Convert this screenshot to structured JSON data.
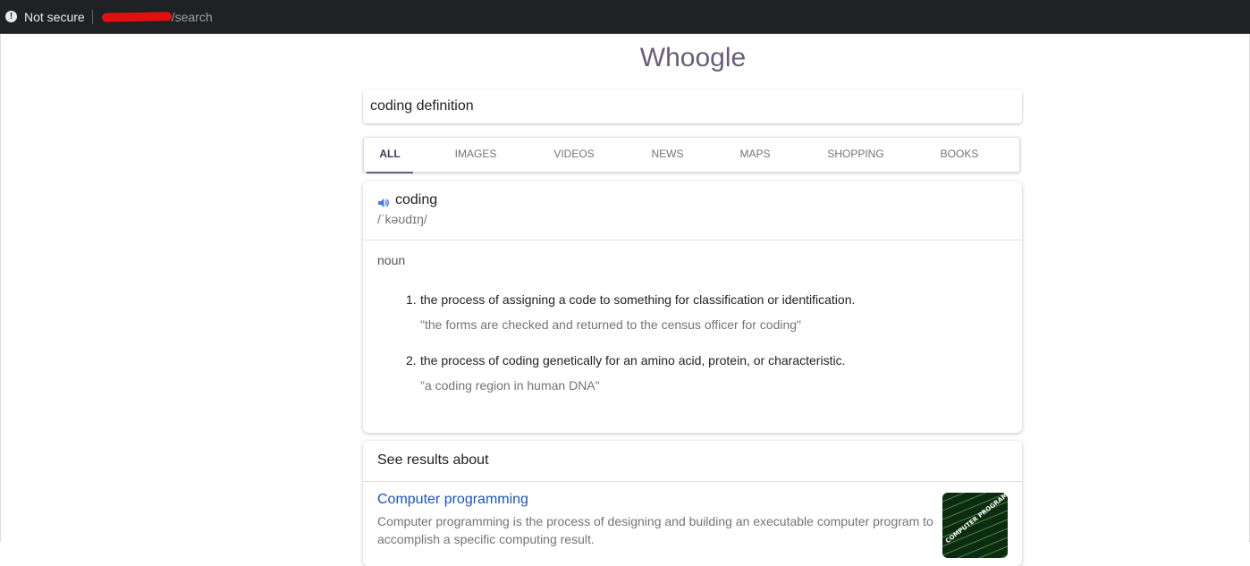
{
  "browser": {
    "security_label": "Not secure",
    "url_path": "/search"
  },
  "logo": "Whoogle",
  "search": {
    "value": "coding definition"
  },
  "tabs": [
    {
      "label": "ALL",
      "active": true
    },
    {
      "label": "IMAGES",
      "active": false
    },
    {
      "label": "VIDEOS",
      "active": false
    },
    {
      "label": "NEWS",
      "active": false
    },
    {
      "label": "MAPS",
      "active": false
    },
    {
      "label": "SHOPPING",
      "active": false
    },
    {
      "label": "BOOKS",
      "active": false
    }
  ],
  "definition": {
    "word": "coding",
    "phonetic": "/ˈkəʊdɪŋ/",
    "part_of_speech": "noun",
    "senses": [
      {
        "number": "1.",
        "text": "the process of assigning a code to something for classification or identification.",
        "example": "\"the forms are checked and returned to the census officer for coding\""
      },
      {
        "number": "2.",
        "text": "the process of coding genetically for an amino acid, protein, or characteristic.",
        "example": "\"a coding region in human DNA\""
      }
    ]
  },
  "about": {
    "title": "See results about",
    "result_title": "Computer programming",
    "result_snippet": "Computer programming is the process of designing and building an executable computer program to accomplish a specific computing result.",
    "thumbnail_caption": "COMPUTER PROGRAMMING"
  },
  "colors": {
    "accent": "#685e79",
    "link": "#1a54c4",
    "browser_bar": "#202124"
  }
}
